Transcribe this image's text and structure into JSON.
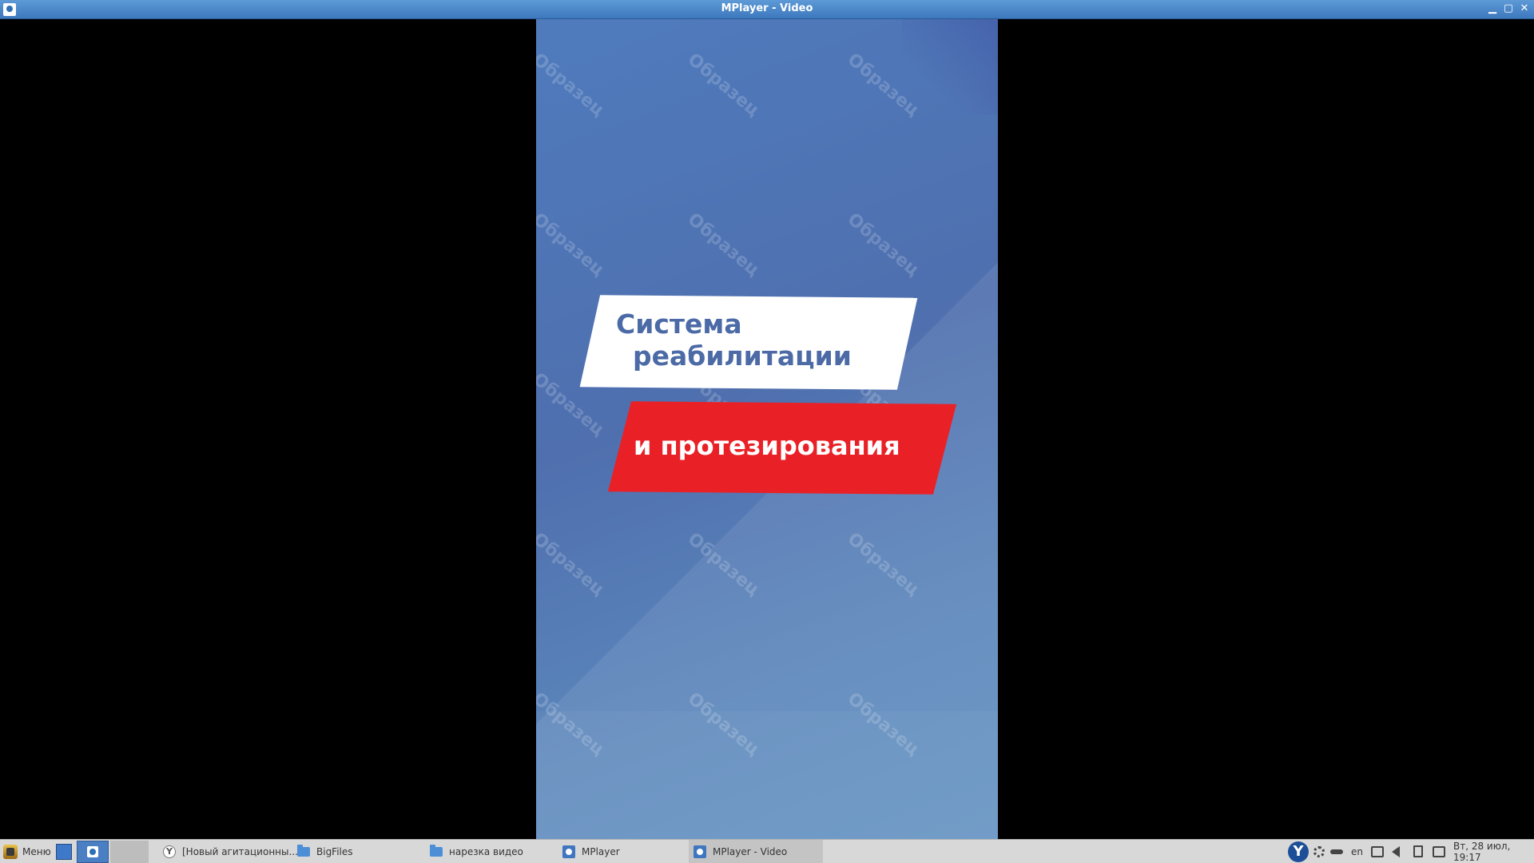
{
  "window": {
    "title": "MPlayer - Video",
    "buttons": [
      "minimize",
      "maximize",
      "close"
    ]
  },
  "video": {
    "watermark": "Образец",
    "line1": "Система",
    "line2": "реабилитации",
    "line3": "и протезирования",
    "colors": {
      "background": "#4f7bbd",
      "text_blue": "#4b6aa6",
      "banner_red": "#e92127"
    }
  },
  "taskbar": {
    "menu_label": "Меню",
    "tasks": [
      {
        "label": "[Новый агитационны...",
        "icon": "yandex-browser-icon"
      },
      {
        "label": "BigFiles",
        "icon": "folder-icon"
      },
      {
        "label": "нарезка видео",
        "icon": "folder-icon"
      },
      {
        "label": "MPlayer",
        "icon": "mplayer-icon"
      },
      {
        "label": "MPlayer - Video",
        "icon": "mplayer-icon"
      }
    ],
    "tray": {
      "language": "en",
      "clock": "Вт, 28 июл, 19:17"
    }
  }
}
